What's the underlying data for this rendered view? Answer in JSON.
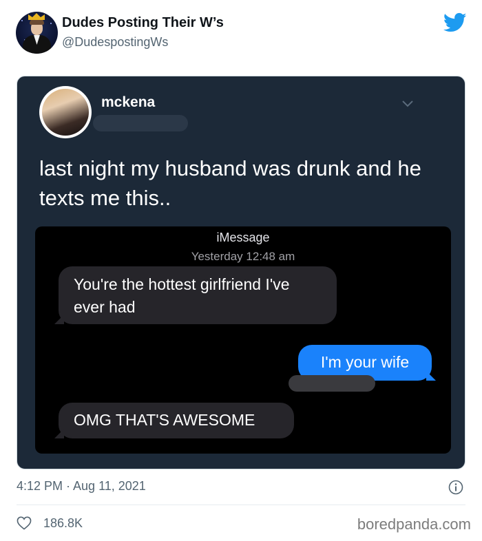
{
  "tweet": {
    "author": {
      "display_name": "Dudes Posting Their W’s",
      "handle": "@DudespostingWs",
      "avatar_icon": "avatar-icon"
    },
    "brand_icon": "twitter-bird-icon",
    "brand_color": "#1d9bf0",
    "timestamp": "4:12 PM · Aug 11, 2021",
    "likes": "186.8K"
  },
  "embedded_post": {
    "author_name": "mckena",
    "text": "last night my husband was drunk and he texts me this..",
    "background": "#1c2938"
  },
  "imessage": {
    "service": "iMessage",
    "date": "Yesterday 12:48 am",
    "messages": [
      {
        "direction": "received",
        "text": "You're the hottest girlfriend I've ever had"
      },
      {
        "direction": "sent",
        "text": "I'm your wife"
      },
      {
        "direction": "received",
        "text": "OMG THAT'S AWESOME"
      }
    ],
    "sent_color": "#1a82fb",
    "received_color": "#26252a"
  },
  "watermark": "boredpanda.com"
}
